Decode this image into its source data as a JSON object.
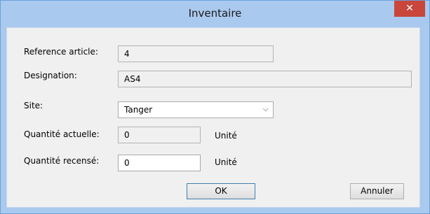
{
  "window": {
    "title": "Inventaire",
    "close_glyph": "✕"
  },
  "form": {
    "reference": {
      "label": "Reference article:",
      "value": "4"
    },
    "designation": {
      "label": "Designation:",
      "value": "AS4"
    },
    "site": {
      "label": "Site:",
      "value": "Tanger"
    },
    "quantite_actuelle": {
      "label": "Quantité actuelle:",
      "value": "0",
      "unit": "Unité"
    },
    "quantite_recensee": {
      "label": "Quantité recensé:",
      "value": "0",
      "unit": "Unité"
    }
  },
  "buttons": {
    "ok": "OK",
    "cancel": "Annuler"
  },
  "icons": {
    "close": "close-icon",
    "dropdown": "chevron-down-icon"
  },
  "colors": {
    "titlebar": "#aac9ef",
    "close_button": "#c8463c",
    "client_bg": "#f0f0f0"
  }
}
